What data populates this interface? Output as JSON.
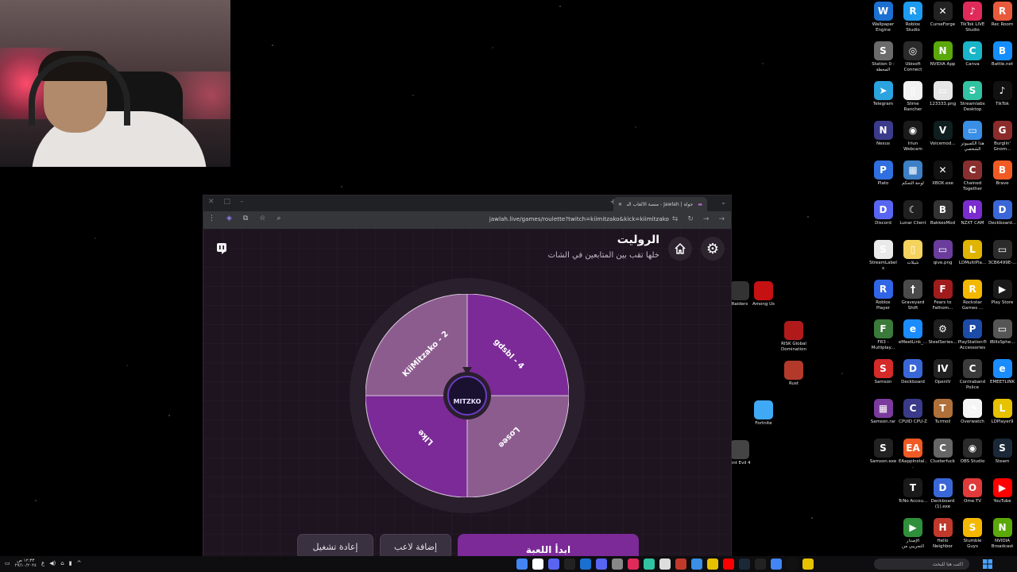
{
  "desktop": {
    "icons": [
      {
        "label": "Wallpaper Engine",
        "color": "#1b6fd1",
        "glyph": "W"
      },
      {
        "label": "Roblox Studio",
        "color": "#1d9bf0",
        "glyph": "R"
      },
      {
        "label": "CurseForge",
        "color": "#222222",
        "glyph": "✕"
      },
      {
        "label": "TikTok LIVE Studio",
        "color": "#e02a5a",
        "glyph": "♪"
      },
      {
        "label": "Rec Room",
        "color": "#e85a3c",
        "glyph": "R"
      },
      {
        "label": "Station 0 - المحطة",
        "color": "#6b6b6b",
        "glyph": "S"
      },
      {
        "label": "Ubisoft Connect",
        "color": "#2a2a2a",
        "glyph": "◎"
      },
      {
        "label": "NVIDIA App",
        "color": "#5aa80a",
        "glyph": "N"
      },
      {
        "label": "Canva",
        "color": "#19b5c8",
        "glyph": "C"
      },
      {
        "label": "Battle.net",
        "color": "#148eff",
        "glyph": "B"
      },
      {
        "label": "Telegram",
        "color": "#2aa3df",
        "glyph": "➤"
      },
      {
        "label": "Slime Rancher",
        "color": "#f2f2f2",
        "glyph": "▯"
      },
      {
        "label": "123333.png",
        "color": "#e6e6e6",
        "glyph": "▭"
      },
      {
        "label": "Streamlabs Desktop",
        "color": "#31c3a2",
        "glyph": "S"
      },
      {
        "label": "TikTok",
        "color": "#111111",
        "glyph": "♪"
      },
      {
        "label": "Nexus",
        "color": "#3b3b8c",
        "glyph": "N"
      },
      {
        "label": "Iriun Webcam",
        "color": "#1a1a1a",
        "glyph": "◉"
      },
      {
        "label": "Voicemod...",
        "color": "#0f1e1e",
        "glyph": "V"
      },
      {
        "label": "هذا الكمبيوتر الشخصي",
        "color": "#3a8ee6",
        "glyph": "▭"
      },
      {
        "label": "Burglin' Gnom...",
        "color": "#8b2b2b",
        "glyph": "G"
      },
      {
        "label": "Plato",
        "color": "#2f6fe0",
        "glyph": "P"
      },
      {
        "label": "لوحة التحكم",
        "color": "#3c7fc4",
        "glyph": "▦"
      },
      {
        "label": "XBOX.exe",
        "color": "#111111",
        "glyph": "✕"
      },
      {
        "label": "Chained Together",
        "color": "#8a2f2f",
        "glyph": "C"
      },
      {
        "label": "Brave",
        "color": "#f15a24",
        "glyph": "B"
      },
      {
        "label": "Discord",
        "color": "#5865f2",
        "glyph": "D"
      },
      {
        "label": "Lunar Client",
        "color": "#1f1f1f",
        "glyph": "☾"
      },
      {
        "label": "BakkesMod",
        "color": "#333333",
        "glyph": "B"
      },
      {
        "label": "NZXT CAM",
        "color": "#7b2ccf",
        "glyph": "N"
      },
      {
        "label": "Deckboard...",
        "color": "#3a67d8",
        "glyph": "D"
      },
      {
        "label": "StreamLabels",
        "color": "#eaeaea",
        "glyph": "S"
      },
      {
        "label": "شيلات",
        "color": "#f4d35e",
        "glyph": "▯"
      },
      {
        "label": "qive.png",
        "color": "#6a3c9c",
        "glyph": "▭"
      },
      {
        "label": "LDMultiPla...",
        "color": "#e0b400",
        "glyph": "L"
      },
      {
        "label": "3CB6499E-...",
        "color": "#2b2b2b",
        "glyph": "▭"
      },
      {
        "label": "Roblox Player",
        "color": "#3065e6",
        "glyph": "R"
      },
      {
        "label": "Graveyard Shift",
        "color": "#4a4a4a",
        "glyph": "†"
      },
      {
        "label": "Fears to Fathom...",
        "color": "#a01c1c",
        "glyph": "F"
      },
      {
        "label": "Rockstar Games ...",
        "color": "#f5b800",
        "glyph": "R"
      },
      {
        "label": "Play Store",
        "color": "#1a1a1a",
        "glyph": "▶"
      },
      {
        "label": "FR3 - Multiplay...",
        "color": "#3a7a3a",
        "glyph": "F"
      },
      {
        "label": "eMeetLink_...",
        "color": "#1a8cff",
        "glyph": "e"
      },
      {
        "label": "SteelSeries...",
        "color": "#202020",
        "glyph": "⚙"
      },
      {
        "label": "PlayStation® Accessories",
        "color": "#1c4ca8",
        "glyph": "P"
      },
      {
        "label": "iBillsSphe...",
        "color": "#555555",
        "glyph": "▭"
      },
      {
        "label": "Samson",
        "color": "#d42a2a",
        "glyph": "S"
      },
      {
        "label": "Deckboard",
        "color": "#3a67d8",
        "glyph": "D"
      },
      {
        "label": "OpenIV",
        "color": "#222222",
        "glyph": "IV"
      },
      {
        "label": "Contraband Police",
        "color": "#3b3b3b",
        "glyph": "C"
      },
      {
        "label": "EMEETLINK",
        "color": "#1a8cff",
        "glyph": "e"
      },
      {
        "label": "Samson.rar",
        "color": "#7a3b9c",
        "glyph": "▦"
      },
      {
        "label": "CPUID CPU-Z",
        "color": "#3a3a8a",
        "glyph": "C"
      },
      {
        "label": "Turmoil",
        "color": "#b0703a",
        "glyph": "T"
      },
      {
        "label": "Overwatch",
        "color": "#f5f5f5",
        "glyph": "◔"
      },
      {
        "label": "LDPlayer9",
        "color": "#e6c200",
        "glyph": "L"
      },
      {
        "label": "Samson.exe",
        "color": "#222222",
        "glyph": "S"
      },
      {
        "label": "EAappInstal...",
        "color": "#f15a24",
        "glyph": "EA"
      },
      {
        "label": "Clusterfuck",
        "color": "#666666",
        "glyph": "C"
      },
      {
        "label": "OBS Studio",
        "color": "#2b2b2b",
        "glyph": "◉"
      },
      {
        "label": "Steam",
        "color": "#1b2838",
        "glyph": "S"
      },
      {
        "label": "",
        "color": "transparent",
        "glyph": ""
      },
      {
        "label": "TcNo Accou...",
        "color": "#1a1a1a",
        "glyph": "T"
      },
      {
        "label": "Deckboard (1).exe",
        "color": "#3a67d8",
        "glyph": "D"
      },
      {
        "label": "Ome.TV",
        "color": "#e03a3a",
        "glyph": "O"
      },
      {
        "label": "YouTube",
        "color": "#ff0000",
        "glyph": "▶"
      },
      {
        "label": "",
        "color": "transparent",
        "glyph": ""
      },
      {
        "label": "الإصدار التجريبي من",
        "color": "#2f8f3a",
        "glyph": "▶"
      },
      {
        "label": "Hello Neighbor",
        "color": "#c0392b",
        "glyph": "H"
      },
      {
        "label": "Stumble Guys",
        "color": "#f5b800",
        "glyph": "S"
      },
      {
        "label": "NVIDIA Broadcast",
        "color": "#5aa80a",
        "glyph": "N"
      }
    ],
    "extra": [
      {
        "label": "Among Us",
        "color": "#c51111"
      },
      {
        "label": "RISK Global Domination",
        "color": "#b01a1a"
      },
      {
        "label": "Rust",
        "color": "#b33a2a"
      },
      {
        "label": "Fortnite",
        "color": "#3fa9f5"
      },
      {
        "label": "Raiders",
        "color": "#333333"
      },
      {
        "label": "lent Evil 4",
        "color": "#444444"
      }
    ]
  },
  "browser": {
    "tab_title": "جولة | Jawlah - منصة الألعاب الت...",
    "url": "jawlah.live/games/roulette?twitch=kiimitzako&kick=kiimitzako"
  },
  "page": {
    "title": "الروليت",
    "subtitle": "خلها تقب بين المتابعين في الشات",
    "center_logo_text": "MITZKO",
    "wheel": {
      "segments": [
        {
          "label": "gdsbl - 4",
          "color": "#7b2a97"
        },
        {
          "label": "Losee",
          "color": "#8c5c8f"
        },
        {
          "label": "Llke",
          "color": "#7b2a97"
        },
        {
          "label": "KiiMitzako - 2",
          "color": "#8c5c8f"
        }
      ]
    },
    "buttons": {
      "start": "ابدأ اللعبة",
      "add_player": "إضافة لاعب",
      "restart": "إعادة تشغيل"
    }
  },
  "taskbar": {
    "time": "١٢:٣٣ ص",
    "date": "٢٧/١٠/٢٠٢٤",
    "search_placeholder": "اكتب هنا للبحث"
  }
}
